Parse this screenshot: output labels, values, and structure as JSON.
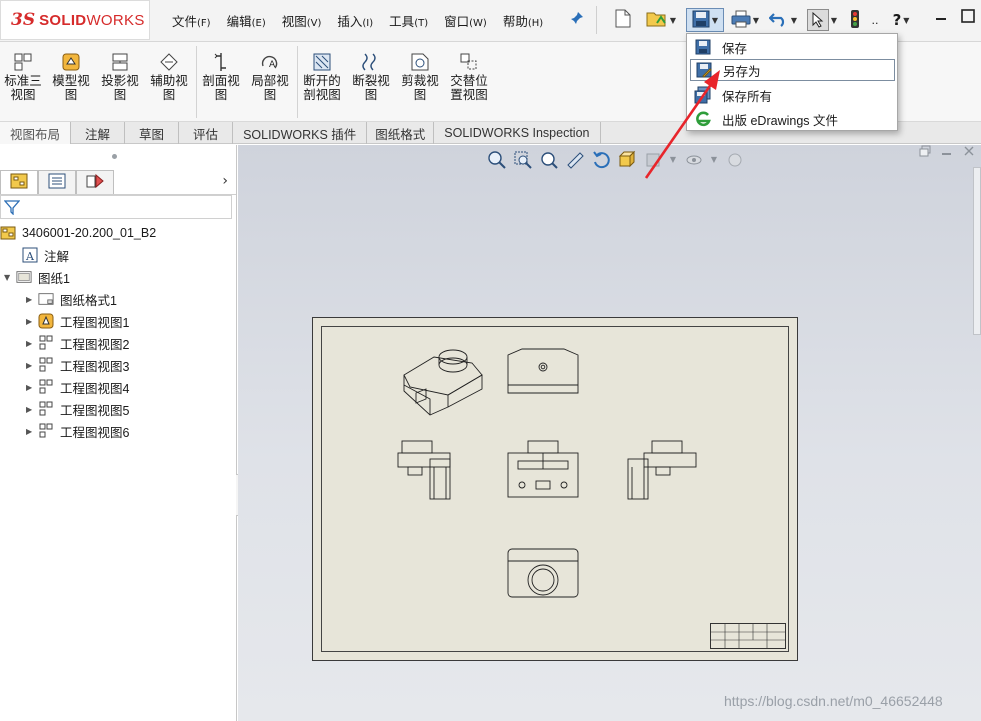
{
  "app": {
    "logo_ds": "3S",
    "logo_brand_bold": "SOLID",
    "logo_brand_light": "WORKS"
  },
  "menubar": [
    {
      "label": "文件",
      "key": "(F)"
    },
    {
      "label": "编辑",
      "key": "(E)"
    },
    {
      "label": "视图",
      "key": "(V)"
    },
    {
      "label": "插入",
      "key": "(I)"
    },
    {
      "label": "工具",
      "key": "(T)"
    },
    {
      "label": "窗口",
      "key": "(W)"
    },
    {
      "label": "帮助",
      "key": "(H)"
    }
  ],
  "toolbar": {
    "help_glyph": "?",
    "more_glyph": ".."
  },
  "ribbon": {
    "buttons": [
      {
        "line1": "标准三",
        "line2": "视图",
        "icon": "standard-3-view-icon"
      },
      {
        "line1": "模型视",
        "line2": "图",
        "icon": "model-view-icon"
      },
      {
        "line1": "投影视",
        "line2": "图",
        "icon": "projected-view-icon"
      },
      {
        "line1": "辅助视",
        "line2": "图",
        "icon": "auxiliary-view-icon"
      },
      {
        "line1": "剖面视",
        "line2": "图",
        "icon": "section-view-icon"
      },
      {
        "line1": "局部视",
        "line2": "图",
        "icon": "detail-view-icon"
      },
      {
        "line1": "断开的",
        "line2": "剖视图",
        "icon": "broken-out-section-icon"
      },
      {
        "line1": "断裂视",
        "line2": "图",
        "icon": "break-view-icon"
      },
      {
        "line1": "剪裁视",
        "line2": "图",
        "icon": "crop-view-icon"
      },
      {
        "line1": "交替位",
        "line2": "置视图",
        "icon": "alternate-position-view-icon"
      }
    ]
  },
  "tabs": [
    {
      "label": "视图布局",
      "active": true
    },
    {
      "label": "注解",
      "active": false
    },
    {
      "label": "草图",
      "active": false
    },
    {
      "label": "评估",
      "active": false
    },
    {
      "label": "SOLIDWORKS 插件",
      "active": false
    },
    {
      "label": "图纸格式",
      "active": false
    },
    {
      "label": "SOLIDWORKS Inspection",
      "active": false
    }
  ],
  "tree": {
    "root": "3406001-20.200_01_B2",
    "items": [
      {
        "label": "注解",
        "icon": "annotations-icon"
      },
      {
        "label": "图纸1",
        "icon": "sheet-icon"
      },
      {
        "label": "图纸格式1",
        "icon": "sheet-format-icon"
      },
      {
        "label": "工程图视图1",
        "icon": "isometric-view-icon"
      },
      {
        "label": "工程图视图2",
        "icon": "drawing-view-icon"
      },
      {
        "label": "工程图视图3",
        "icon": "drawing-view-icon"
      },
      {
        "label": "工程图视图4",
        "icon": "drawing-view-icon"
      },
      {
        "label": "工程图视图5",
        "icon": "drawing-view-icon"
      },
      {
        "label": "工程图视图6",
        "icon": "drawing-view-icon"
      }
    ]
  },
  "save_menu": {
    "items": [
      {
        "label": "保存",
        "icon": "save-icon"
      },
      {
        "label": "另存为",
        "icon": "save-as-icon",
        "highlighted": true
      },
      {
        "label": "保存所有",
        "icon": "save-all-icon"
      },
      {
        "label": "出版 eDrawings 文件",
        "icon": "edrawings-icon"
      }
    ]
  },
  "watermark": "https://blog.csdn.net/m0_46652448",
  "colors": {
    "brand_red": "#d62b2b",
    "annotation_arrow": "#e8252b",
    "accent_blue": "#2a6fb8",
    "sheet_paper": "#e7e5d9",
    "graphics_bg": "#cfd3dc"
  }
}
